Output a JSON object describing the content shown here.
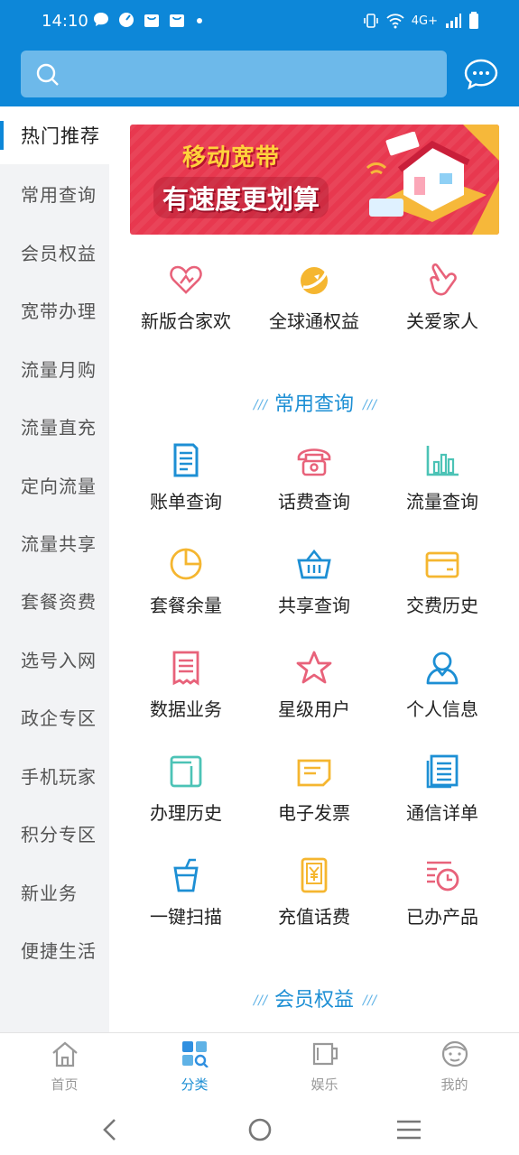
{
  "status_bar": {
    "time": "14:10",
    "network": "4G+"
  },
  "search": {
    "placeholder": ""
  },
  "sidebar": {
    "items": [
      {
        "label": "热门推荐",
        "active": true
      },
      {
        "label": "常用查询"
      },
      {
        "label": "会员权益"
      },
      {
        "label": "宽带办理"
      },
      {
        "label": "流量月购"
      },
      {
        "label": "流量直充"
      },
      {
        "label": "定向流量"
      },
      {
        "label": "流量共享"
      },
      {
        "label": "套餐资费"
      },
      {
        "label": "选号入网"
      },
      {
        "label": "政企专区"
      },
      {
        "label": "手机玩家"
      },
      {
        "label": "积分专区"
      },
      {
        "label": "新业务"
      },
      {
        "label": "便捷生活"
      }
    ]
  },
  "banner": {
    "line1": "移动宽带",
    "line2": "有速度更划算"
  },
  "featured": [
    {
      "label": "新版合家欢",
      "icon": "heart-icon",
      "color": "#e8627a"
    },
    {
      "label": "全球通权益",
      "icon": "globe-swoosh-icon",
      "color": "#f5b630"
    },
    {
      "label": "关爱家人",
      "icon": "hand-icon",
      "color": "#e8627a"
    }
  ],
  "common_query": {
    "title": "常用查询",
    "items": [
      {
        "label": "账单查询",
        "icon": "bill-icon",
        "color": "#1d8fd4"
      },
      {
        "label": "话费查询",
        "icon": "telephone-icon",
        "color": "#e8627a"
      },
      {
        "label": "流量查询",
        "icon": "bar-chart-icon",
        "color": "#4cc3b6"
      },
      {
        "label": "套餐余量",
        "icon": "pie-chart-icon",
        "color": "#f5b630"
      },
      {
        "label": "共享查询",
        "icon": "basket-icon",
        "color": "#1d8fd4"
      },
      {
        "label": "交费历史",
        "icon": "card-icon",
        "color": "#f5b630"
      },
      {
        "label": "数据业务",
        "icon": "receipt-icon",
        "color": "#e8627a"
      },
      {
        "label": "星级用户",
        "icon": "star-icon",
        "color": "#e8627a"
      },
      {
        "label": "个人信息",
        "icon": "user-icon",
        "color": "#1d8fd4"
      },
      {
        "label": "办理历史",
        "icon": "wallet-icon",
        "color": "#4cc3b6"
      },
      {
        "label": "电子发票",
        "icon": "invoice-icon",
        "color": "#f5b630"
      },
      {
        "label": "通信详单",
        "icon": "list-doc-icon",
        "color": "#1d8fd4"
      },
      {
        "label": "一键扫描",
        "icon": "cup-icon",
        "color": "#1d8fd4"
      },
      {
        "label": "充值话费",
        "icon": "yen-phone-icon",
        "color": "#f5b630"
      },
      {
        "label": "已办产品",
        "icon": "clock-list-icon",
        "color": "#e8627a"
      }
    ]
  },
  "member_rights": {
    "title": "会员权益"
  },
  "tabbar": {
    "tabs": [
      {
        "label": "首页",
        "icon": "home-icon"
      },
      {
        "label": "分类",
        "icon": "category-icon",
        "active": true
      },
      {
        "label": "娱乐",
        "icon": "mug-icon"
      },
      {
        "label": "我的",
        "icon": "face-icon"
      }
    ]
  }
}
